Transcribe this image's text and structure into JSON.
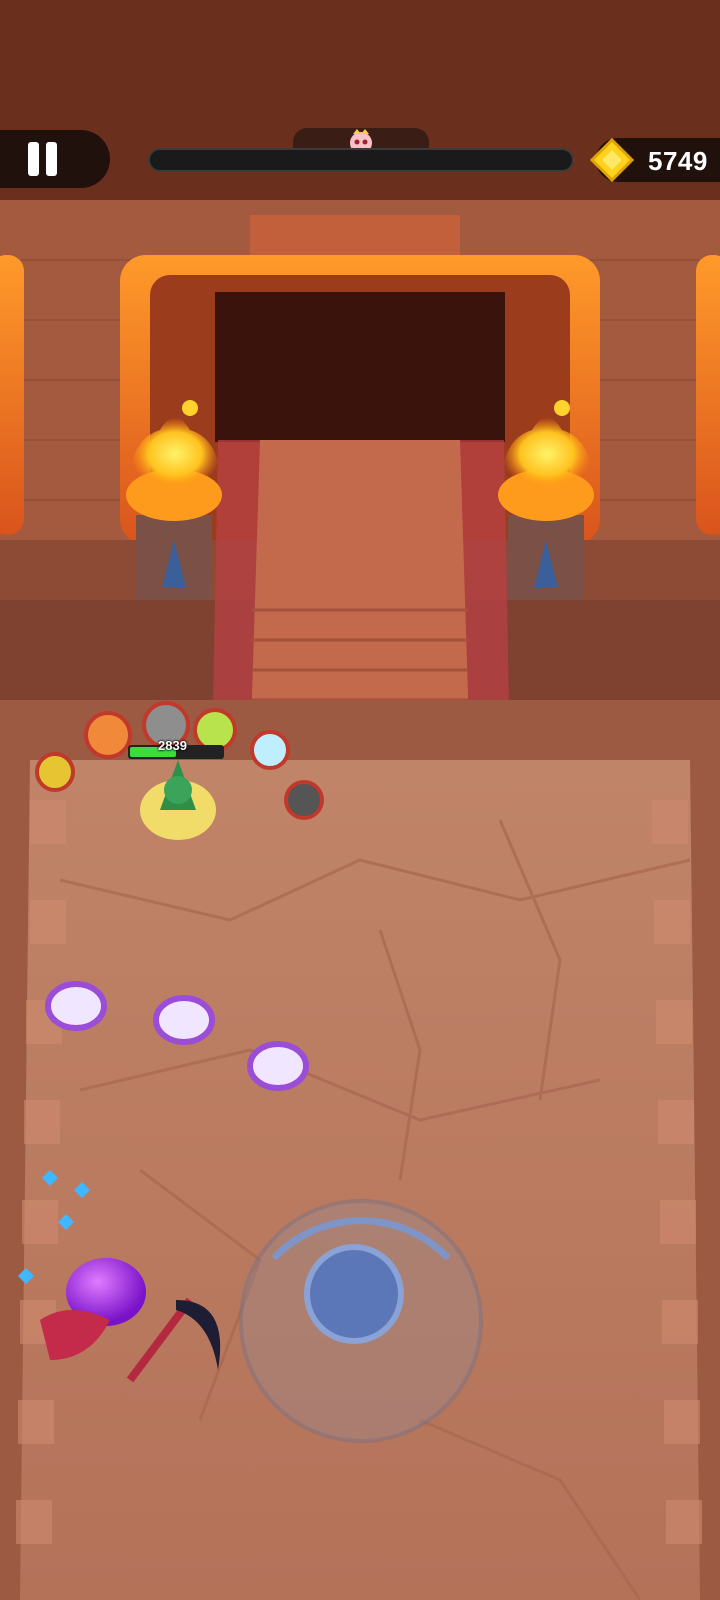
{
  "hud": {
    "coins": "5749",
    "boss_hp_fraction": 0.0,
    "player_hp": "2839",
    "player_hp_fraction": 0.5
  },
  "icons": {
    "pause": "pause-icon",
    "coin": "coin-icon",
    "boss": "boss-skull-icon",
    "joystick": "joystick-icon"
  },
  "colors": {
    "floor": "#b97a60",
    "wall": "#8e4a33",
    "fire": "#ffd22e",
    "carpet": "#b84044",
    "hp_green": "#3ddc3d",
    "joystick_knob": "#5b77b8"
  }
}
